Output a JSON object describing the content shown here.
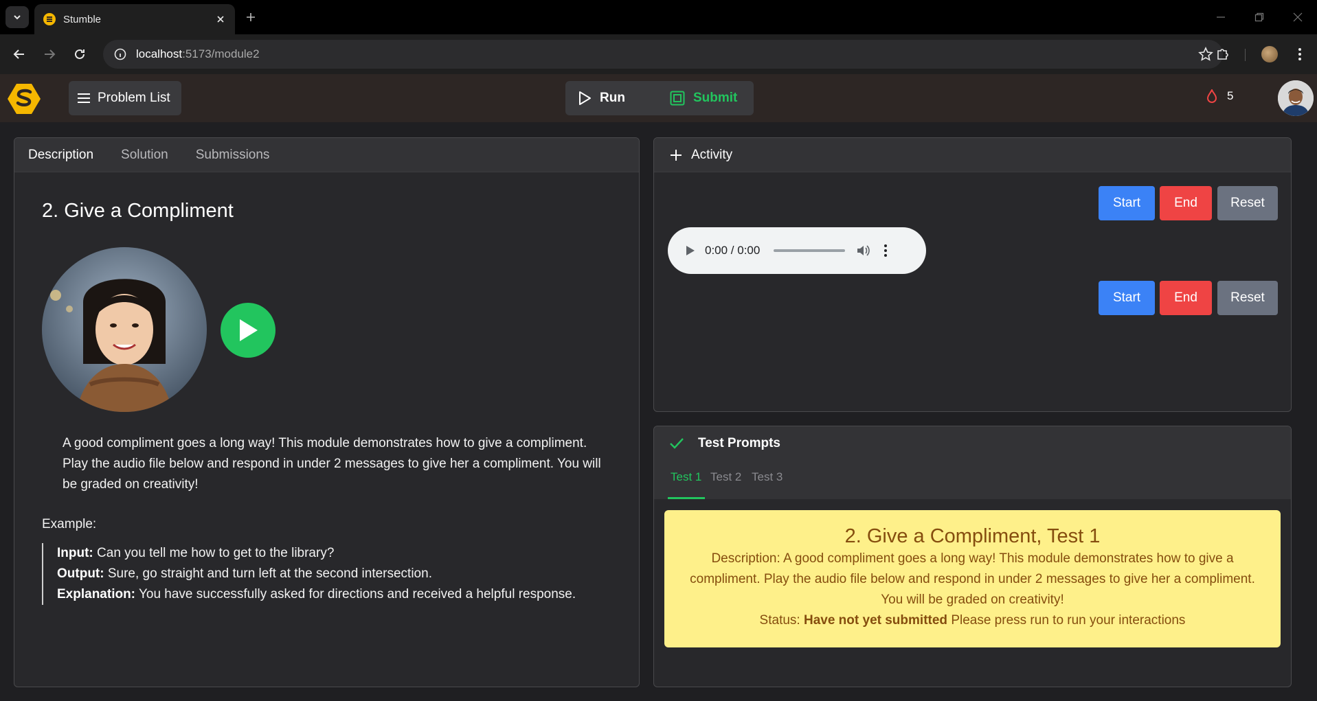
{
  "browser": {
    "tab_title": "Stumble",
    "url_host": "localhost",
    "url_path": ":5173/module2"
  },
  "header": {
    "problem_list_label": "Problem List",
    "run_label": "Run",
    "submit_label": "Submit",
    "streak_count": "5",
    "colors": {
      "header_bg": "#2d2624",
      "submit": "#22c55e",
      "streak": "#ef4444"
    }
  },
  "left": {
    "tabs": [
      "Description",
      "Solution",
      "Submissions"
    ],
    "active_tab": "Description",
    "title": "2. Give a Compliment",
    "description": "A good compliment goes a long way! This module demonstrates how to give a compliment. Play the audio file below and respond in under 2 messages to give her a compliment. You will be graded on creativity!",
    "example_label": "Example:",
    "example": {
      "input_label": "Input:",
      "input_text": "Can you tell me how to get to the library?",
      "output_label": "Output:",
      "output_text": "Sure, go straight and turn left at the second intersection.",
      "explanation_label": "Explanation:",
      "explanation_text": "You have successfully asked for directions and received a helpful response."
    }
  },
  "activity": {
    "title": "Activity",
    "start_label": "Start",
    "end_label": "End",
    "reset_label": "Reset",
    "audio_time": "0:00 / 0:00"
  },
  "tests": {
    "title": "Test Prompts",
    "tabs": [
      "Test 1",
      "Test 2",
      "Test 3"
    ],
    "active_tab": "Test 1",
    "card_title": "2. Give a Compliment, Test 1",
    "card_description": "Description: A good compliment goes a long way! This module demonstrates how to give a compliment. Play the audio file below and respond in under 2 messages to give her a compliment. You will be graded on creativity!",
    "status_label": "Status:",
    "status_value": "Have not yet submitted",
    "status_note": "Please press run to run your interactions"
  }
}
